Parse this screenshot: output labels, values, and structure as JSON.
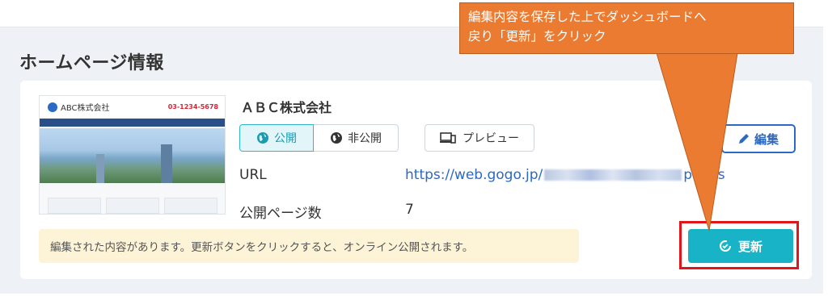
{
  "section": {
    "title": "ホームページ情報"
  },
  "thumbnail": {
    "logo_text": "ABC株式会社",
    "tel": "03-1234-5678"
  },
  "site": {
    "name": "ＡＢＣ株式会社",
    "publish_label": "公開",
    "unpublish_label": "非公開",
    "preview_label": "プレビュー",
    "edit_label": "編集",
    "url_label": "URL",
    "url_prefix": "https://web.gogo.jp/",
    "url_suffix": "pages",
    "pages_label": "公開ページ数",
    "pages_value": "7"
  },
  "notice": {
    "text": "編集された内容があります。更新ボタンをクリックすると、オンライン公開されます。"
  },
  "update": {
    "label": "更新"
  },
  "callout": {
    "line1": "編集内容を保存した上でダッシュボードへ",
    "line2": "戻り「更新」をクリック"
  },
  "colors": {
    "accent": "#19b3c8",
    "link": "#2a69c4",
    "callout": "#ec7b32",
    "highlight": "#e0161b",
    "notice_bg": "#fdf3d6"
  }
}
